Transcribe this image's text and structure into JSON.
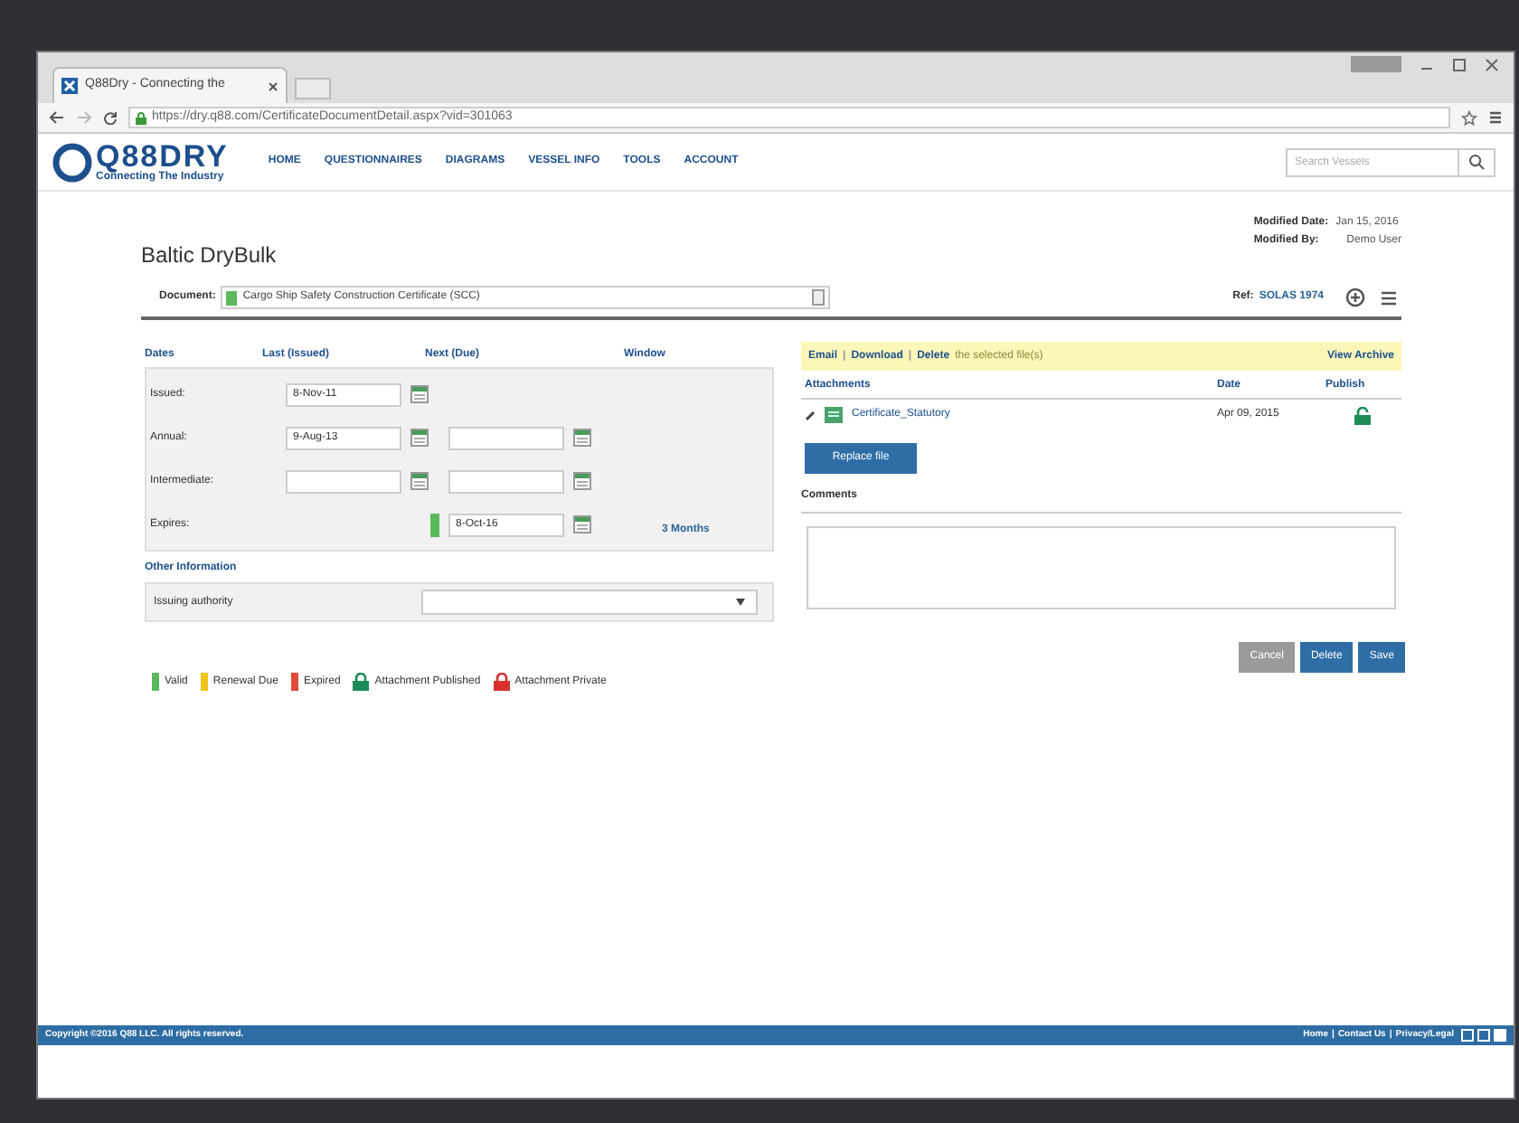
{
  "browser": {
    "tab_title": "Q88Dry - Connecting the",
    "url": "https://dry.q88.com/CertificateDocumentDetail.aspx?vid=301063"
  },
  "site": {
    "logo": "Q88DRY",
    "tagline": "Connecting The Industry",
    "nav": [
      {
        "label": "HOME"
      },
      {
        "label": "QUESTIONNAIRES"
      },
      {
        "label": "DIAGRAMS"
      },
      {
        "label": "VESSEL INFO"
      },
      {
        "label": "TOOLS"
      },
      {
        "label": "ACCOUNT"
      }
    ],
    "search": {
      "placeholder": "Search Vessels"
    }
  },
  "page": {
    "title": "Baltic DryBulk",
    "modified_date_label": "Modified Date:",
    "modified_date": "Jan 15, 2016",
    "modified_by_label": "Modified By:",
    "modified_by": "Demo User"
  },
  "document": {
    "label": "Document:",
    "value": "Cargo Ship Safety Construction Certificate (SCC)",
    "ref_label": "Ref:",
    "ref": "SOLAS 1974"
  },
  "dates_table": {
    "columns": [
      "Dates",
      "Last (Issued)",
      "Next (Due)",
      "Window"
    ],
    "rows": [
      {
        "label": "Issued:",
        "last": {
          "value": "8-Nov-11"
        }
      },
      {
        "label": "Annual:",
        "last": {
          "value": "9-Aug-13"
        },
        "next": {
          "empty": true
        }
      },
      {
        "label": "Intermediate:",
        "last": {
          "empty": true
        },
        "next": {
          "empty": true
        }
      },
      {
        "label": "Expires:",
        "next": {
          "value": "8-Oct-16",
          "color": "#5cb85c"
        },
        "window": "3 Months"
      }
    ]
  },
  "other_information": {
    "title": "Other Information",
    "issuing_authority_label": "Issuing authority"
  },
  "legend": [
    {
      "kind": "bar",
      "label": "Valid",
      "color": "#5cb85c"
    },
    {
      "kind": "bar",
      "label": "Renewal Due",
      "color": "#f0c419"
    },
    {
      "kind": "bar",
      "label": "Expired",
      "color": "#e04b3a"
    },
    {
      "kind": "lock",
      "label": "Attachment Published",
      "color": "#1e8a55"
    },
    {
      "kind": "lock",
      "label": "Attachment Private",
      "color": "#d8312c"
    }
  ],
  "attachments": {
    "actions": [
      "Email",
      "Download",
      "Delete"
    ],
    "actions_separator": "|",
    "actions_suffix": "the selected file(s)",
    "view_archive": "View Archive",
    "columns": [
      "Attachments",
      "Date",
      "Publish"
    ],
    "rows": [
      {
        "name": "Certificate_Statutory",
        "date": "Apr 09, 2015",
        "published": true
      }
    ],
    "replace_button": "Replace file",
    "comments_label": "Comments"
  },
  "buttons": [
    {
      "label": "Cancel",
      "kind": "secondary"
    },
    {
      "label": "Delete",
      "kind": "primary"
    },
    {
      "label": "Save",
      "kind": "primary"
    }
  ],
  "footer": {
    "copyright": "Copyright ©2016 Q88 LLC. All rights reserved.",
    "links": [
      "Home",
      "Contact Us",
      "Privacy/Legal"
    ],
    "separator": "|"
  }
}
